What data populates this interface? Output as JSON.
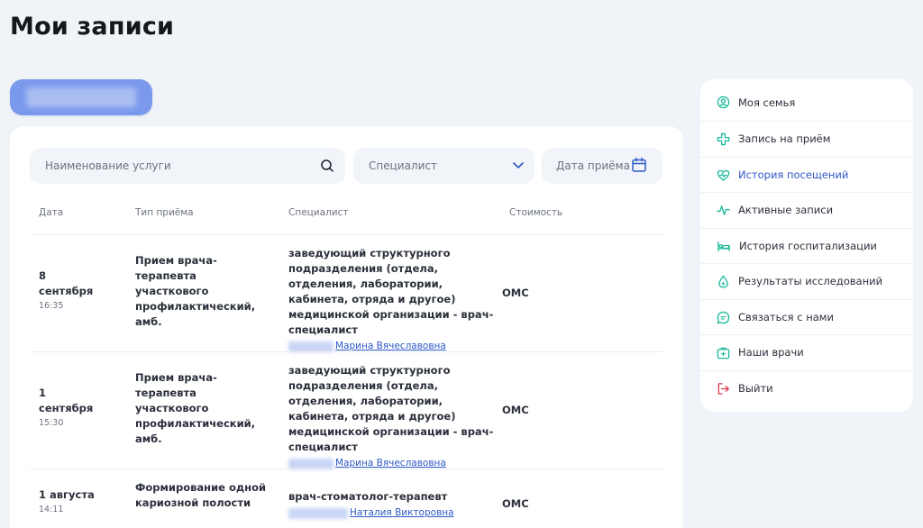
{
  "page": {
    "title": "Мои записи"
  },
  "filters": {
    "service_placeholder": "Наименование услуги",
    "specialist_placeholder": "Специалист",
    "date_placeholder": "Дата приёма"
  },
  "table": {
    "columns": [
      "Дата",
      "Тип приёма",
      "Специалист",
      "Стоимость"
    ],
    "rows": [
      {
        "day": "8",
        "month": "сентября",
        "time": "16:35",
        "type": "Прием врача-терапевта участкового профилактический, амб.",
        "specialist": "заведующий структурного подразделения (отдела, отделения, лаборатории, кабинета, отряда и другое) медицинской организации - врач-специалист",
        "doctor": "Марина Вячеславовна",
        "cost": "ОМС"
      },
      {
        "day": "1",
        "month": "сентября",
        "time": "15:30",
        "type": "Прием врача-терапевта участкового профилактический, амб.",
        "specialist": "заведующий структурного подразделения (отдела, отделения, лаборатории, кабинета, отряда и другое) медицинской организации - врач-специалист",
        "doctor": "Марина Вячеславовна",
        "cost": "ОМС"
      },
      {
        "day": "1 августа",
        "month": "",
        "time": "14:11",
        "type": "Формирование одной кариозной полости",
        "specialist": "врач-стоматолог-терапевт",
        "doctor": "Наталия Викторовна",
        "cost": "ОМС"
      }
    ]
  },
  "menu": {
    "accent": "#2d58c8",
    "icon_color": "#1bb99a",
    "logout_color": "#e0384b",
    "items": [
      {
        "label": "Моя семья",
        "icon": "user-circle-icon"
      },
      {
        "label": "Запись на приём",
        "icon": "plus-icon"
      },
      {
        "label": "История посещений",
        "icon": "heart-pulse-icon",
        "active": true
      },
      {
        "label": "Активные записи",
        "icon": "pulse-icon"
      },
      {
        "label": "История госпитализации",
        "icon": "bed-icon"
      },
      {
        "label": "Результаты исследований",
        "icon": "drop-icon"
      },
      {
        "label": "Связаться с нами",
        "icon": "chat-icon"
      },
      {
        "label": "Наши врачи",
        "icon": "medkit-icon"
      },
      {
        "label": "Выйти",
        "icon": "logout-icon"
      }
    ]
  }
}
